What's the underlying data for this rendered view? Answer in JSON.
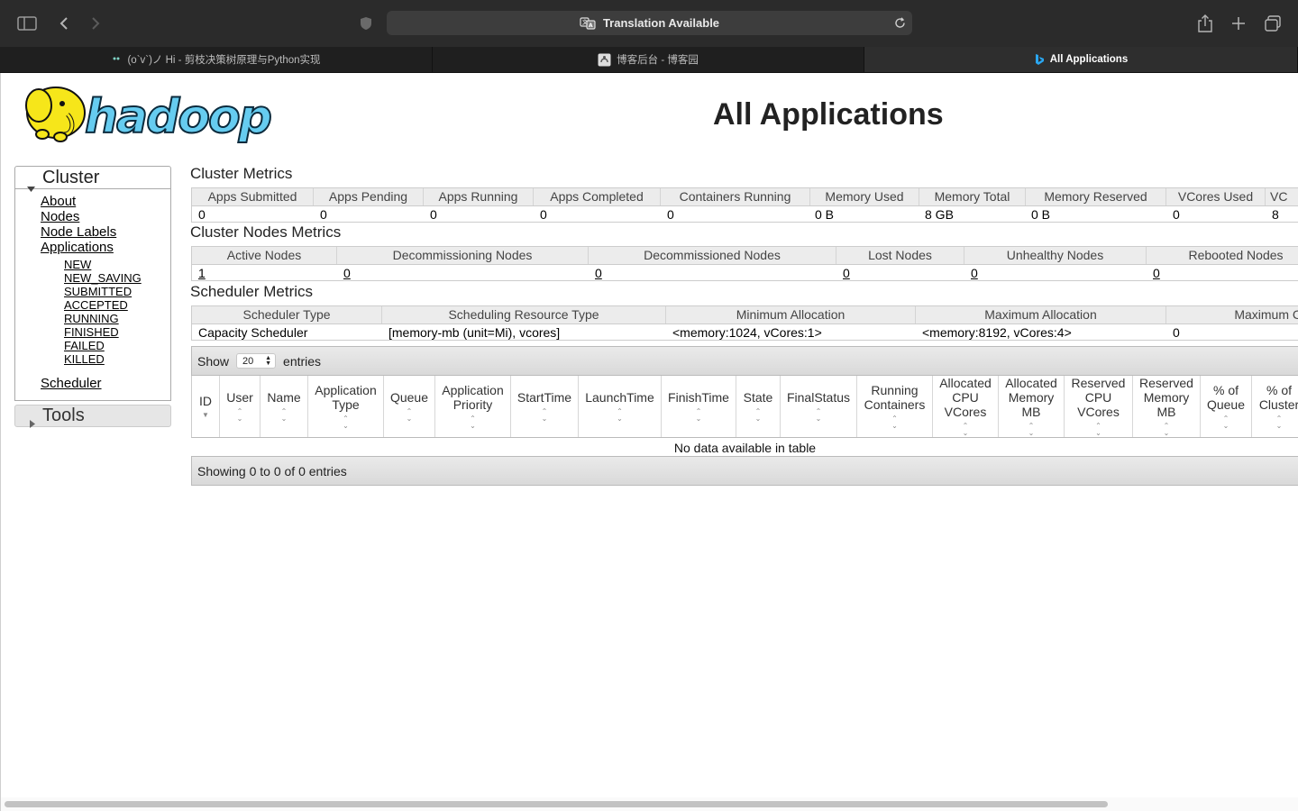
{
  "browser": {
    "address_text": "Translation Available",
    "tabs": [
      {
        "title": "(o`v`)ノ Hi - 剪枝决策树原理与Python实现",
        "favicon": "cat-icon"
      },
      {
        "title": "博客后台 - 博客园",
        "favicon": "cnblogs-icon"
      },
      {
        "title": "All Applications",
        "favicon": "bing-icon"
      }
    ]
  },
  "page": {
    "logo_text": "hadoop",
    "title": "All Applications"
  },
  "nav": {
    "cluster_label": "Cluster",
    "tools_label": "Tools",
    "links": [
      "About",
      "Nodes",
      "Node Labels",
      "Applications"
    ],
    "app_states": [
      "NEW",
      "NEW_SAVING",
      "SUBMITTED",
      "ACCEPTED",
      "RUNNING",
      "FINISHED",
      "FAILED",
      "KILLED"
    ],
    "scheduler": "Scheduler"
  },
  "cluster_metrics": {
    "title": "Cluster Metrics",
    "headers": [
      "Apps Submitted",
      "Apps Pending",
      "Apps Running",
      "Apps Completed",
      "Containers Running",
      "Memory Used",
      "Memory Total",
      "Memory Reserved",
      "VCores Used",
      "VC"
    ],
    "values": [
      "0",
      "0",
      "0",
      "0",
      "0",
      "0 B",
      "8 GB",
      "0 B",
      "0",
      "8"
    ]
  },
  "nodes_metrics": {
    "title": "Cluster Nodes Metrics",
    "headers": [
      "Active Nodes",
      "Decommissioning Nodes",
      "Decommissioned Nodes",
      "Lost Nodes",
      "Unhealthy Nodes",
      "Rebooted Nodes"
    ],
    "values": [
      "1",
      "0",
      "0",
      "0",
      "0",
      "0"
    ]
  },
  "scheduler_metrics": {
    "title": "Scheduler Metrics",
    "headers": [
      "Scheduler Type",
      "Scheduling Resource Type",
      "Minimum Allocation",
      "Maximum Allocation",
      "Maximum C"
    ],
    "values": [
      "Capacity Scheduler",
      "[memory-mb (unit=Mi), vcores]",
      "<memory:1024, vCores:1>",
      "<memory:8192, vCores:4>",
      "0"
    ]
  },
  "apps_table": {
    "show_label": "Show",
    "page_size": "20",
    "entries_label": "entries",
    "columns": [
      "ID",
      "User",
      "Name",
      "Application\nType",
      "Queue",
      "Application\nPriority",
      "StartTime",
      "LaunchTime",
      "FinishTime",
      "State",
      "FinalStatus",
      "Running\nContainers",
      "Allocated\nCPU\nVCores",
      "Allocated\nMemory\nMB",
      "Reserved\nCPU\nVCores",
      "Reserved\nMemory\nMB",
      "% of\nQueue",
      "% of\nCluster"
    ],
    "empty_text": "No data available in table",
    "info_text": "Showing 0 to 0 of 0 entries"
  }
}
